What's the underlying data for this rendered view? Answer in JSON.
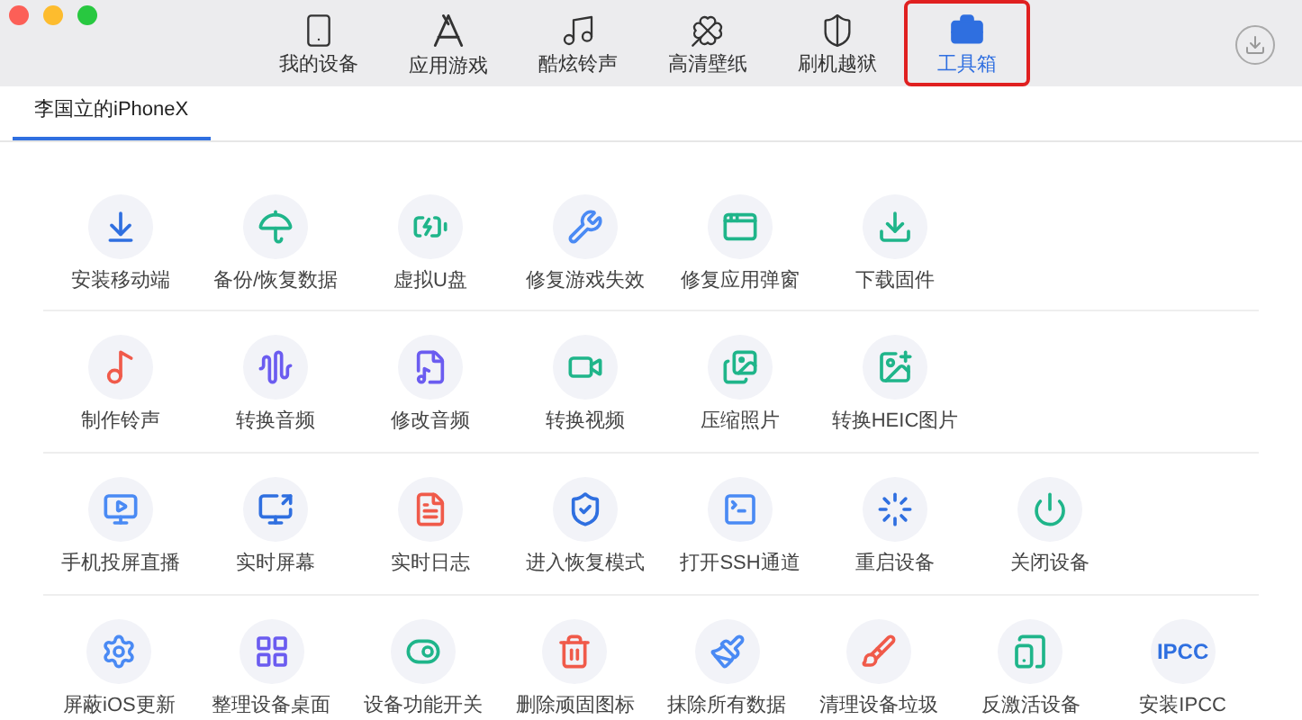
{
  "nav": [
    {
      "label": "我的设备",
      "selected": false
    },
    {
      "label": "应用游戏",
      "selected": false
    },
    {
      "label": "酷炫铃声",
      "selected": false
    },
    {
      "label": "高清壁纸",
      "selected": false
    },
    {
      "label": "刷机越狱",
      "selected": false
    },
    {
      "label": "工具箱",
      "selected": true
    }
  ],
  "device_tab": {
    "label": "李国立的iPhoneX",
    "selected": true
  },
  "tool_rows": [
    [
      {
        "label": "安装移动端",
        "kind": "icon"
      },
      {
        "label": "备份/恢复数据",
        "kind": "icon"
      },
      {
        "label": "虚拟U盘",
        "kind": "icon"
      },
      {
        "label": "修复游戏失效",
        "kind": "icon"
      },
      {
        "label": "修复应用弹窗",
        "kind": "icon"
      },
      {
        "label": "下载固件",
        "kind": "icon"
      }
    ],
    [
      {
        "label": "制作铃声",
        "kind": "icon"
      },
      {
        "label": "转换音频",
        "kind": "icon"
      },
      {
        "label": "修改音频",
        "kind": "icon"
      },
      {
        "label": "转换视频",
        "kind": "icon"
      },
      {
        "label": "压缩照片",
        "kind": "icon"
      },
      {
        "label": "转换HEIC图片",
        "kind": "icon"
      }
    ],
    [
      {
        "label": "手机投屏直播",
        "kind": "icon"
      },
      {
        "label": "实时屏幕",
        "kind": "icon"
      },
      {
        "label": "实时日志",
        "kind": "icon"
      },
      {
        "label": "进入恢复模式",
        "kind": "icon"
      },
      {
        "label": "打开SSH通道",
        "kind": "icon"
      },
      {
        "label": "重启设备",
        "kind": "icon"
      },
      {
        "label": "关闭设备",
        "kind": "icon"
      }
    ],
    [
      {
        "label": "屏蔽iOS更新",
        "kind": "icon"
      },
      {
        "label": "整理设备桌面",
        "kind": "icon"
      },
      {
        "label": "设备功能开关",
        "kind": "icon"
      },
      {
        "label": "删除顽固图标",
        "kind": "icon"
      },
      {
        "label": "抹除所有数据",
        "kind": "icon"
      },
      {
        "label": "清理设备垃圾",
        "kind": "icon"
      },
      {
        "label": "反激活设备",
        "kind": "icon"
      },
      {
        "label": "安装IPCC",
        "kind": "text",
        "glyph": "IPCC"
      }
    ]
  ]
}
